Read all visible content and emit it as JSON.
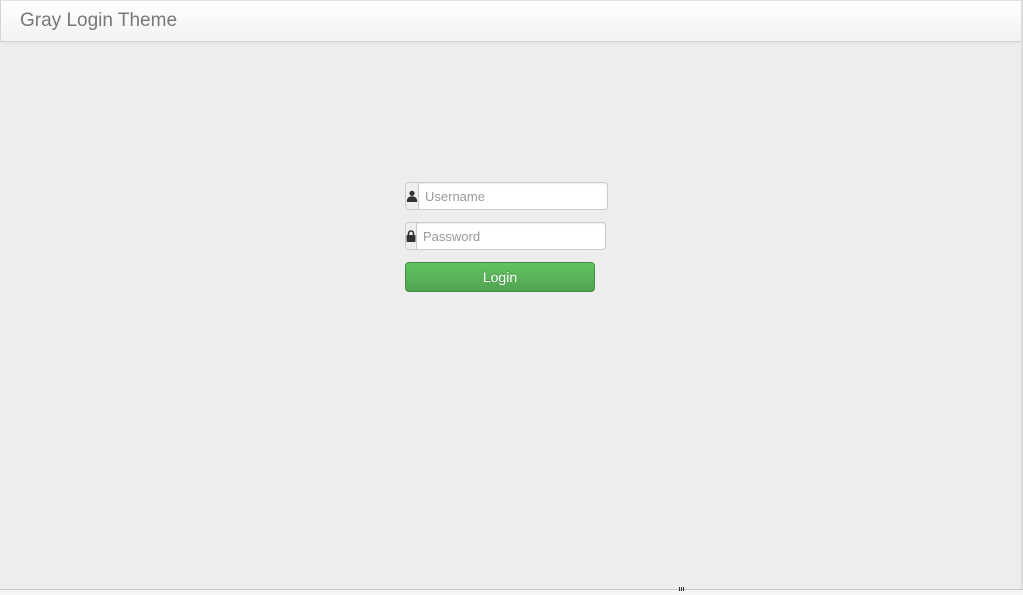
{
  "navbar": {
    "brand": "Gray Login Theme"
  },
  "login": {
    "username_placeholder": "Username",
    "password_placeholder": "Password",
    "button_label": "Login",
    "user_icon": "user-icon",
    "lock_icon": "lock-icon"
  },
  "colors": {
    "background": "#ededed",
    "button": "#51a351",
    "brand_text": "#777777"
  }
}
